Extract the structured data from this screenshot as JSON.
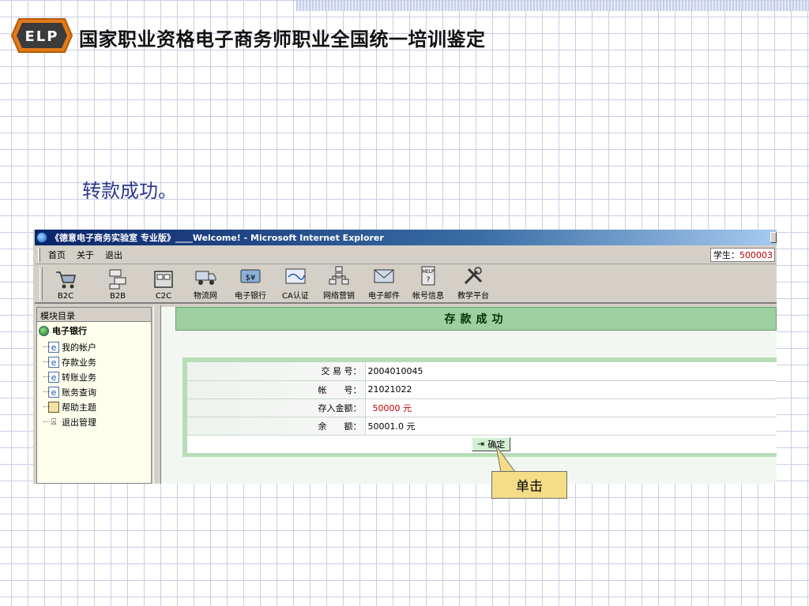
{
  "slide": {
    "title": "国家职业资格电子商务师职业全国统一培训鉴定",
    "caption": "转款成功。",
    "logo_text": "ELP"
  },
  "window": {
    "title": "《德意电子商务实验室 专业版》____Welcome! - Microsoft Internet Explorer",
    "menu": [
      "首页",
      "关于",
      "退出"
    ],
    "student_label": "学生：",
    "student_id": "500003",
    "toolbar": [
      {
        "label": "B2C",
        "icon": "cart-icon"
      },
      {
        "label": "B2B",
        "icon": "network-icon"
      },
      {
        "label": "C2C",
        "icon": "c2c-icon"
      },
      {
        "label": "物流网",
        "icon": "truck-icon"
      },
      {
        "label": "电子银行",
        "icon": "bank-icon"
      },
      {
        "label": "CA认证",
        "icon": "certificate-icon"
      },
      {
        "label": "网络营销",
        "icon": "org-chart-icon"
      },
      {
        "label": "电子邮件",
        "icon": "mail-icon"
      },
      {
        "label": "帐号信息",
        "icon": "help-icon"
      },
      {
        "label": "教学平台",
        "icon": "tools-icon"
      }
    ]
  },
  "sidebar": {
    "header": "模块目录",
    "root": "电子银行",
    "items": [
      "我的帐户",
      "存款业务",
      "转账业务",
      "账务查询",
      "帮助主题",
      "退出管理"
    ]
  },
  "main": {
    "banner": "存款成功",
    "rows": [
      {
        "label": "交 易 号：",
        "value": "2004010045"
      },
      {
        "label": "帐　　号：",
        "value": "21021022"
      },
      {
        "label": "存入金额：",
        "value": "50000 元"
      },
      {
        "label": "余　　额：",
        "value": "50001.0 元"
      }
    ],
    "confirm_label": "确定"
  },
  "callout": {
    "text": "单击"
  },
  "colors": {
    "banner": "#9ecfa0",
    "panel": "#b7dcb7",
    "callout": "#f4dd86",
    "red": "#c00000",
    "titlebar": "#0a246a"
  }
}
